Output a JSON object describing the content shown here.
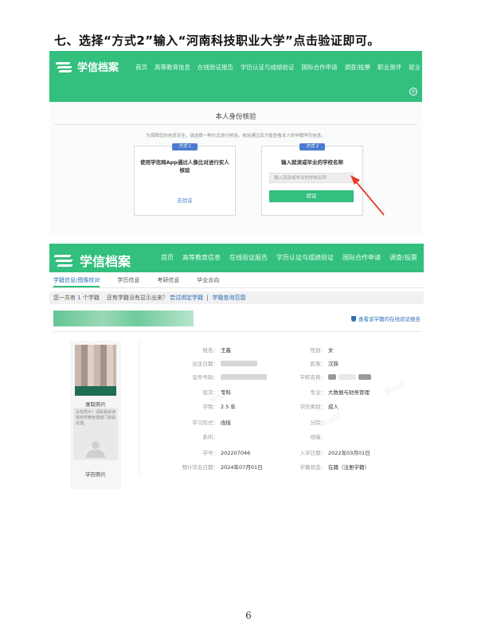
{
  "heading": "七、选择“方式2”输入“河南科技职业大学”点击验证即可。",
  "brand": {
    "accent": "#33bf7e",
    "link": "#2d6fb5"
  },
  "shot1": {
    "logo": "学信档案",
    "nav": [
      "首页",
      "高等教育信息",
      "在线验证报告",
      "学历认证与成绩验证",
      "国际合作申请",
      "调查/投票",
      "职业测评",
      "就业"
    ],
    "title": "本人身份核验",
    "notice": "为保障您的信息安全，请选择一种方式进行核验，核验通过后才能查看本人的学籍学历信息。",
    "option1": {
      "badge": "方式 1",
      "title": "使用学信网App通过人像比对进行实人核验",
      "link": "去验证"
    },
    "option2": {
      "badge": "方式 2",
      "title": "输入就读或毕业的学校名称",
      "placeholder": "输入就读或毕业的学校名称",
      "button": "验证"
    }
  },
  "shot2": {
    "logo": "学信档案",
    "nav": [
      "首页",
      "高等教育信息",
      "在线验证报告",
      "学历认证与成绩验证",
      "国际合作申请",
      "调查/投票"
    ],
    "subnav": [
      "学籍信息/图像校对",
      "学历信息",
      "考研信息",
      "毕业去向"
    ],
    "count": {
      "prefix": "您一共有",
      "num": "1",
      "suffix": "个学籍",
      "question": "还有学籍没有显示出来？",
      "link1": "尝试绑定学籍",
      "sep": "|",
      "link2": "学籍查询范围"
    },
    "report_link": "查看该学籍的在线验证报告",
    "admission_photo_caption": "录取照片",
    "placeholder_text": "没有照片？请联系就读院校学籍管理部门协助处理。",
    "diploma_photo_caption": "学历照片",
    "left_fields": [
      {
        "label": "姓名：",
        "value": "王鑫"
      },
      {
        "label": "出生日期：",
        "value": ""
      },
      {
        "label": "证件号码：",
        "value": ""
      },
      {
        "label": "层次：",
        "value": "专科"
      },
      {
        "label": "学制：",
        "value": "2.5 年"
      },
      {
        "label": "学习形式：",
        "value": "函授"
      },
      {
        "label": "系所：",
        "value": ""
      },
      {
        "label": "学号：",
        "value": "202207046"
      },
      {
        "label": "预计毕业日期：",
        "value": "2024年07月01日"
      }
    ],
    "right_fields": [
      {
        "label": "性别：",
        "value": "女"
      },
      {
        "label": "民族：",
        "value": "汉族"
      },
      {
        "label": "学校名称：",
        "value": ""
      },
      {
        "label": "专业：",
        "value": "大数据与财务管理"
      },
      {
        "label": "学历类别：",
        "value": "成人"
      },
      {
        "label": "分院：",
        "value": ""
      },
      {
        "label": "班级：",
        "value": ""
      },
      {
        "label": "入学日期：",
        "value": "2022年03月01日"
      },
      {
        "label": "学籍状态：",
        "value": "在籍（注册学籍）"
      }
    ],
    "watermark": "学信网"
  },
  "page_number": "6"
}
